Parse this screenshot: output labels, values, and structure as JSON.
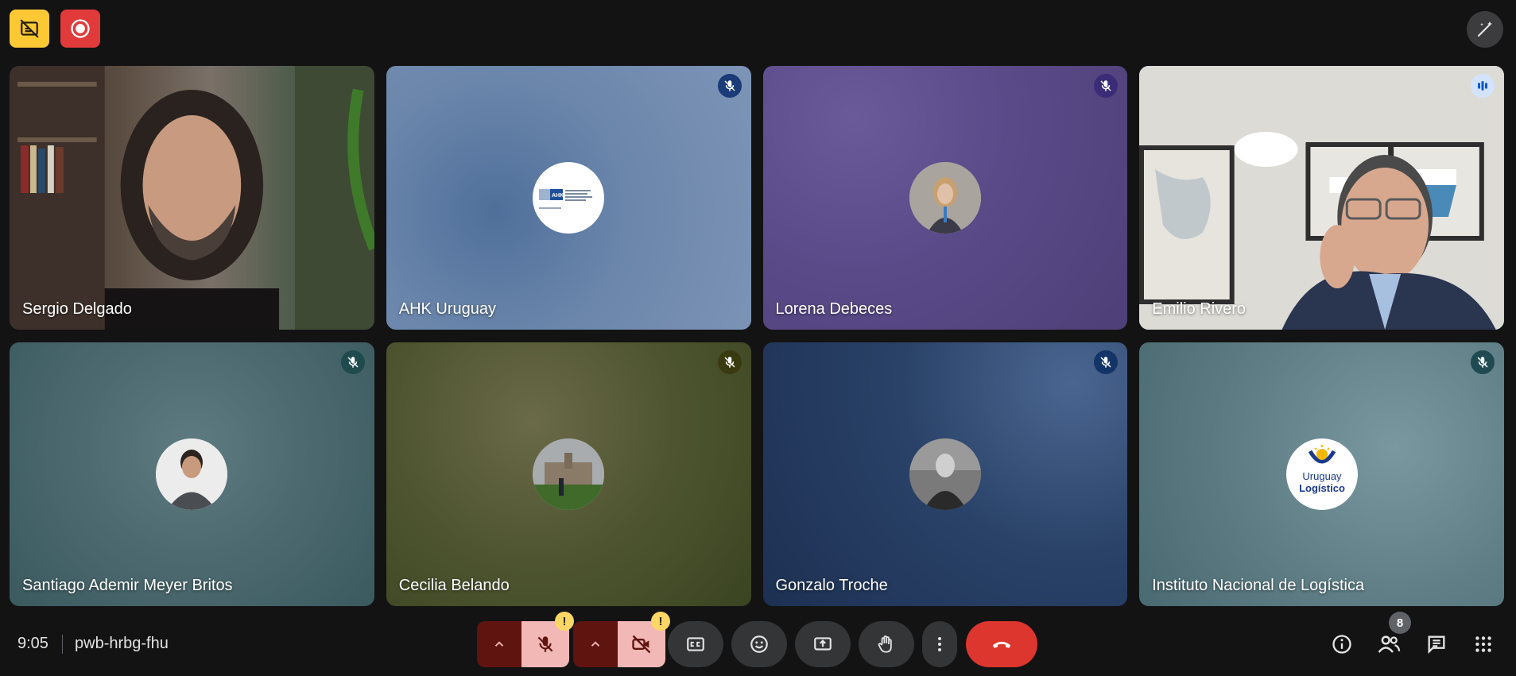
{
  "meeting": {
    "time": "9:05",
    "code": "pwb-hrbg-fhu",
    "participant_count": "8"
  },
  "top_controls": {
    "captions_off_icon": "captions-off-icon",
    "recording_icon": "recording-icon",
    "effects_icon": "magic-wand-icon",
    "colors": {
      "captions": "#fcc934",
      "recording": "#e03a3a"
    }
  },
  "participants": [
    {
      "name": "Sergio Delgado",
      "video": true,
      "muted": false
    },
    {
      "name": "AHK Uruguay",
      "video": false,
      "muted": true
    },
    {
      "name": "Lorena Debeces",
      "video": false,
      "muted": true
    },
    {
      "name": "Emilio Rivero",
      "video": true,
      "speaking": true
    },
    {
      "name": "Santiago Ademir Meyer Britos",
      "video": false,
      "muted": true
    },
    {
      "name": "Cecilia Belando",
      "video": false,
      "muted": true
    },
    {
      "name": "Gonzalo Troche",
      "video": false,
      "muted": true
    },
    {
      "name": "Instituto Nacional de Logística",
      "video": false,
      "muted": true
    }
  ],
  "logo_text": {
    "uruguay_logistico_line1": "Uruguay",
    "uruguay_logistico_line2": "Logístico",
    "ahk": "AHK"
  },
  "bottom_controls": {
    "mic_warning": "!",
    "camera_warning": "!",
    "icons": [
      "chevron-up-icon",
      "mic-off-icon",
      "chevron-up-icon",
      "camera-off-icon",
      "captions-icon",
      "emoji-icon",
      "present-icon",
      "raise-hand-icon",
      "more-options-icon",
      "leave-call-icon",
      "info-icon",
      "people-icon",
      "chat-icon",
      "activities-icon"
    ],
    "colors": {
      "leave": "#dc362e",
      "mic_off_bg": "#f2b8b5",
      "arrow_bg": "#601410"
    }
  }
}
